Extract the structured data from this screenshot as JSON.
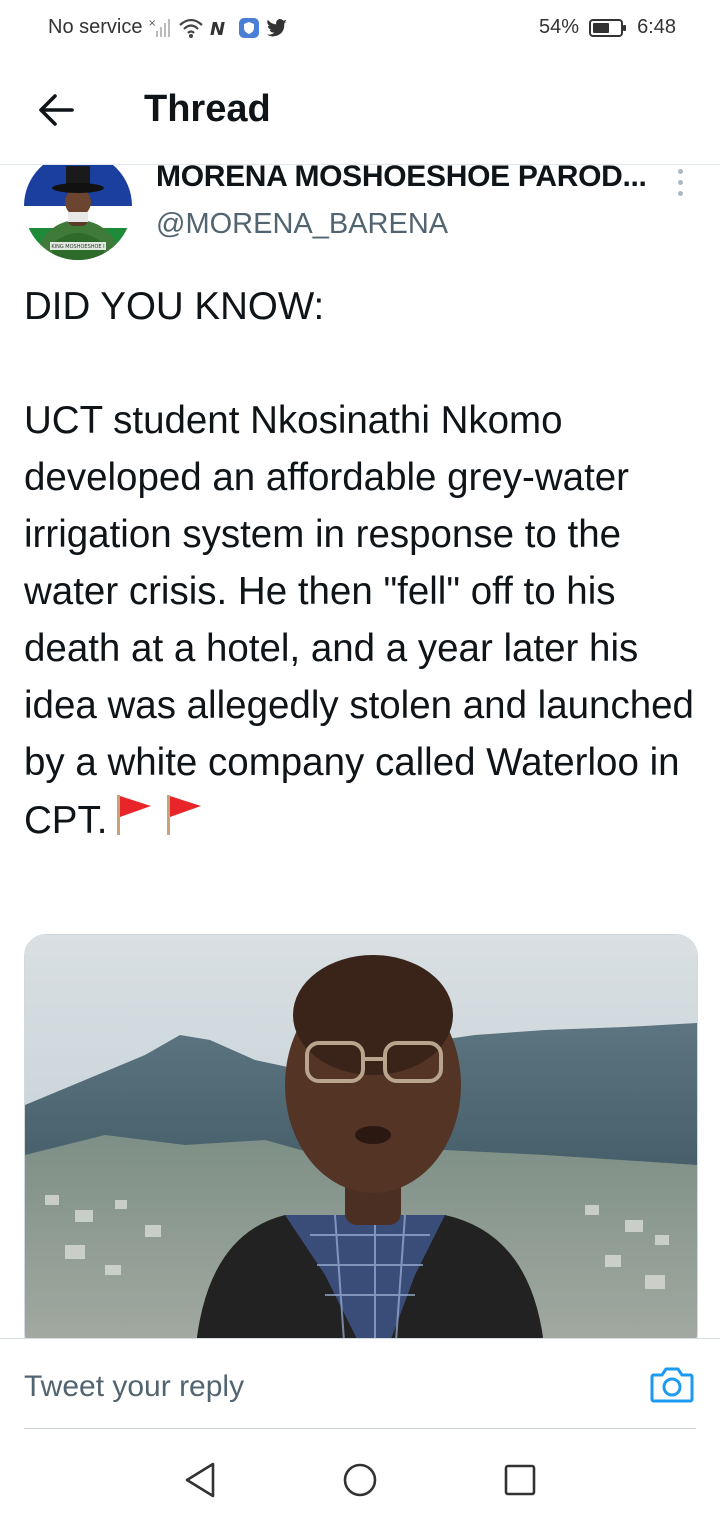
{
  "status_bar": {
    "carrier": "No service",
    "battery": "54%",
    "time": "6:48",
    "icons": [
      "signal-x-icon",
      "wifi-icon",
      "nfc-icon",
      "shield-app-icon",
      "twitter-bird-icon",
      "battery-icon"
    ]
  },
  "header": {
    "back_icon": "arrow-left-icon",
    "title": "Thread"
  },
  "tweet": {
    "display_name": "MORENA MOSHOESHOE PAROD...",
    "handle": "@MORENA_BARENA",
    "avatar_label": "KING MOSHOESHOE I",
    "body": "DID YOU KNOW:\n\nUCT student Nkosinathi Nkomo developed an affordable grey-water irrigation system in response to the water crisis. He then \"fell\" off to his death at a hotel, and a year later his idea was allegedly stolen and launched by a white company called Waterloo in CPT.",
    "trailing_emoji": [
      "red-flag-icon",
      "red-flag-icon"
    ],
    "more_icon": "more-vertical-icon",
    "media_description_icon": "photo-icon"
  },
  "reply": {
    "placeholder": "Tweet your reply",
    "camera_icon": "camera-icon"
  },
  "nav": {
    "icons": [
      "nav-back-icon",
      "nav-home-icon",
      "nav-recents-icon"
    ]
  },
  "colors": {
    "accent": "#1d9bf0",
    "text_primary": "#0f1419",
    "text_secondary": "#536471",
    "flag_red": "#e8262a"
  }
}
